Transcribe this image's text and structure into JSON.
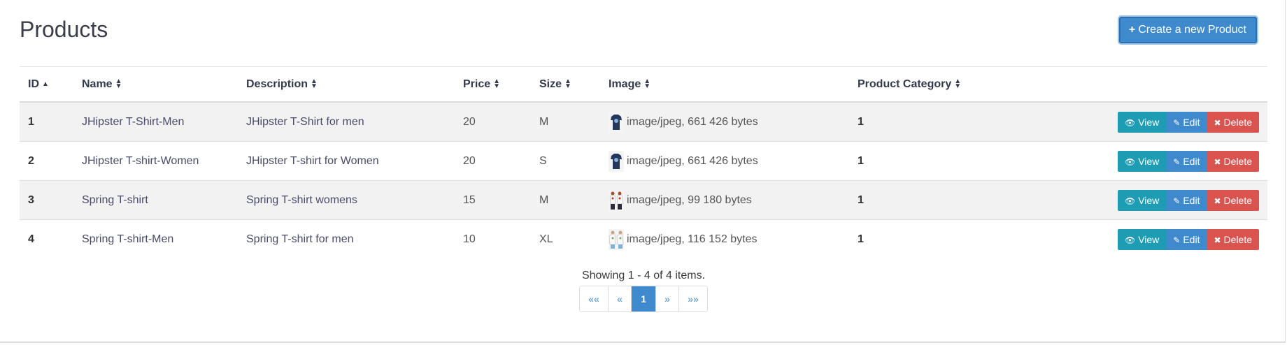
{
  "header": {
    "title": "Products",
    "create_button": "Create a new Product"
  },
  "table": {
    "columns": {
      "id": "ID",
      "name": "Name",
      "description": "Description",
      "price": "Price",
      "size": "Size",
      "image": "Image",
      "category": "Product Category"
    },
    "rows": [
      {
        "id": "1",
        "name": "JHipster T-Shirt-Men",
        "description": "JHipster T-Shirt for men",
        "price": "20",
        "size": "M",
        "image": "image/jpeg, 661 426 bytes",
        "category": "1"
      },
      {
        "id": "2",
        "name": "JHipster T-shirt-Women",
        "description": "JHipster T-shirt for Women",
        "price": "20",
        "size": "S",
        "image": "image/jpeg, 661 426 bytes",
        "category": "1"
      },
      {
        "id": "3",
        "name": "Spring T-shirt",
        "description": "Spring T-shirt womens",
        "price": "15",
        "size": "M",
        "image": "image/jpeg, 99 180 bytes",
        "category": "1"
      },
      {
        "id": "4",
        "name": "Spring T-shirt-Men",
        "description": "Spring T-shirt for men",
        "price": "10",
        "size": "XL",
        "image": "image/jpeg, 116 152 bytes",
        "category": "1"
      }
    ],
    "actions": {
      "view": "View",
      "edit": "Edit",
      "delete": "Delete"
    }
  },
  "pagination": {
    "info": "Showing 1 - 4 of 4 items.",
    "first": "««",
    "prev": "«",
    "current": "1",
    "next": "»",
    "last": "»»"
  },
  "colors": {
    "primary": "#3e8acc",
    "info": "#1e9cb4",
    "danger": "#d9534f"
  }
}
